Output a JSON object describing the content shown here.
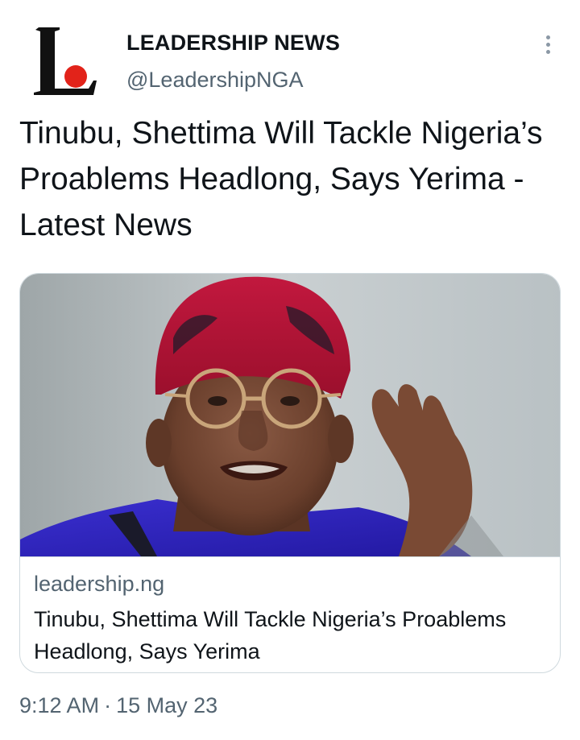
{
  "account": {
    "display_name": "LEADERSHIP NEWS",
    "handle": "@LeadershipNGA",
    "avatar_icon": "leadership-logo",
    "brand_red": "#e2231a"
  },
  "tweet": {
    "text": "Tinubu, Shettima Will Tackle Nigeria’s Proablems Headlong, Says Yerima - Latest News"
  },
  "card": {
    "image_icon": "portrait-photo",
    "domain": "leadership.ng",
    "title": "Tinubu, Shettima Will Tackle Nigeria’s Proablems Headlong, Says Yerima"
  },
  "meta": {
    "time": "9:12 AM",
    "separator": "·",
    "date": "15 May 23"
  },
  "more_icon": "more-vertical-icon"
}
